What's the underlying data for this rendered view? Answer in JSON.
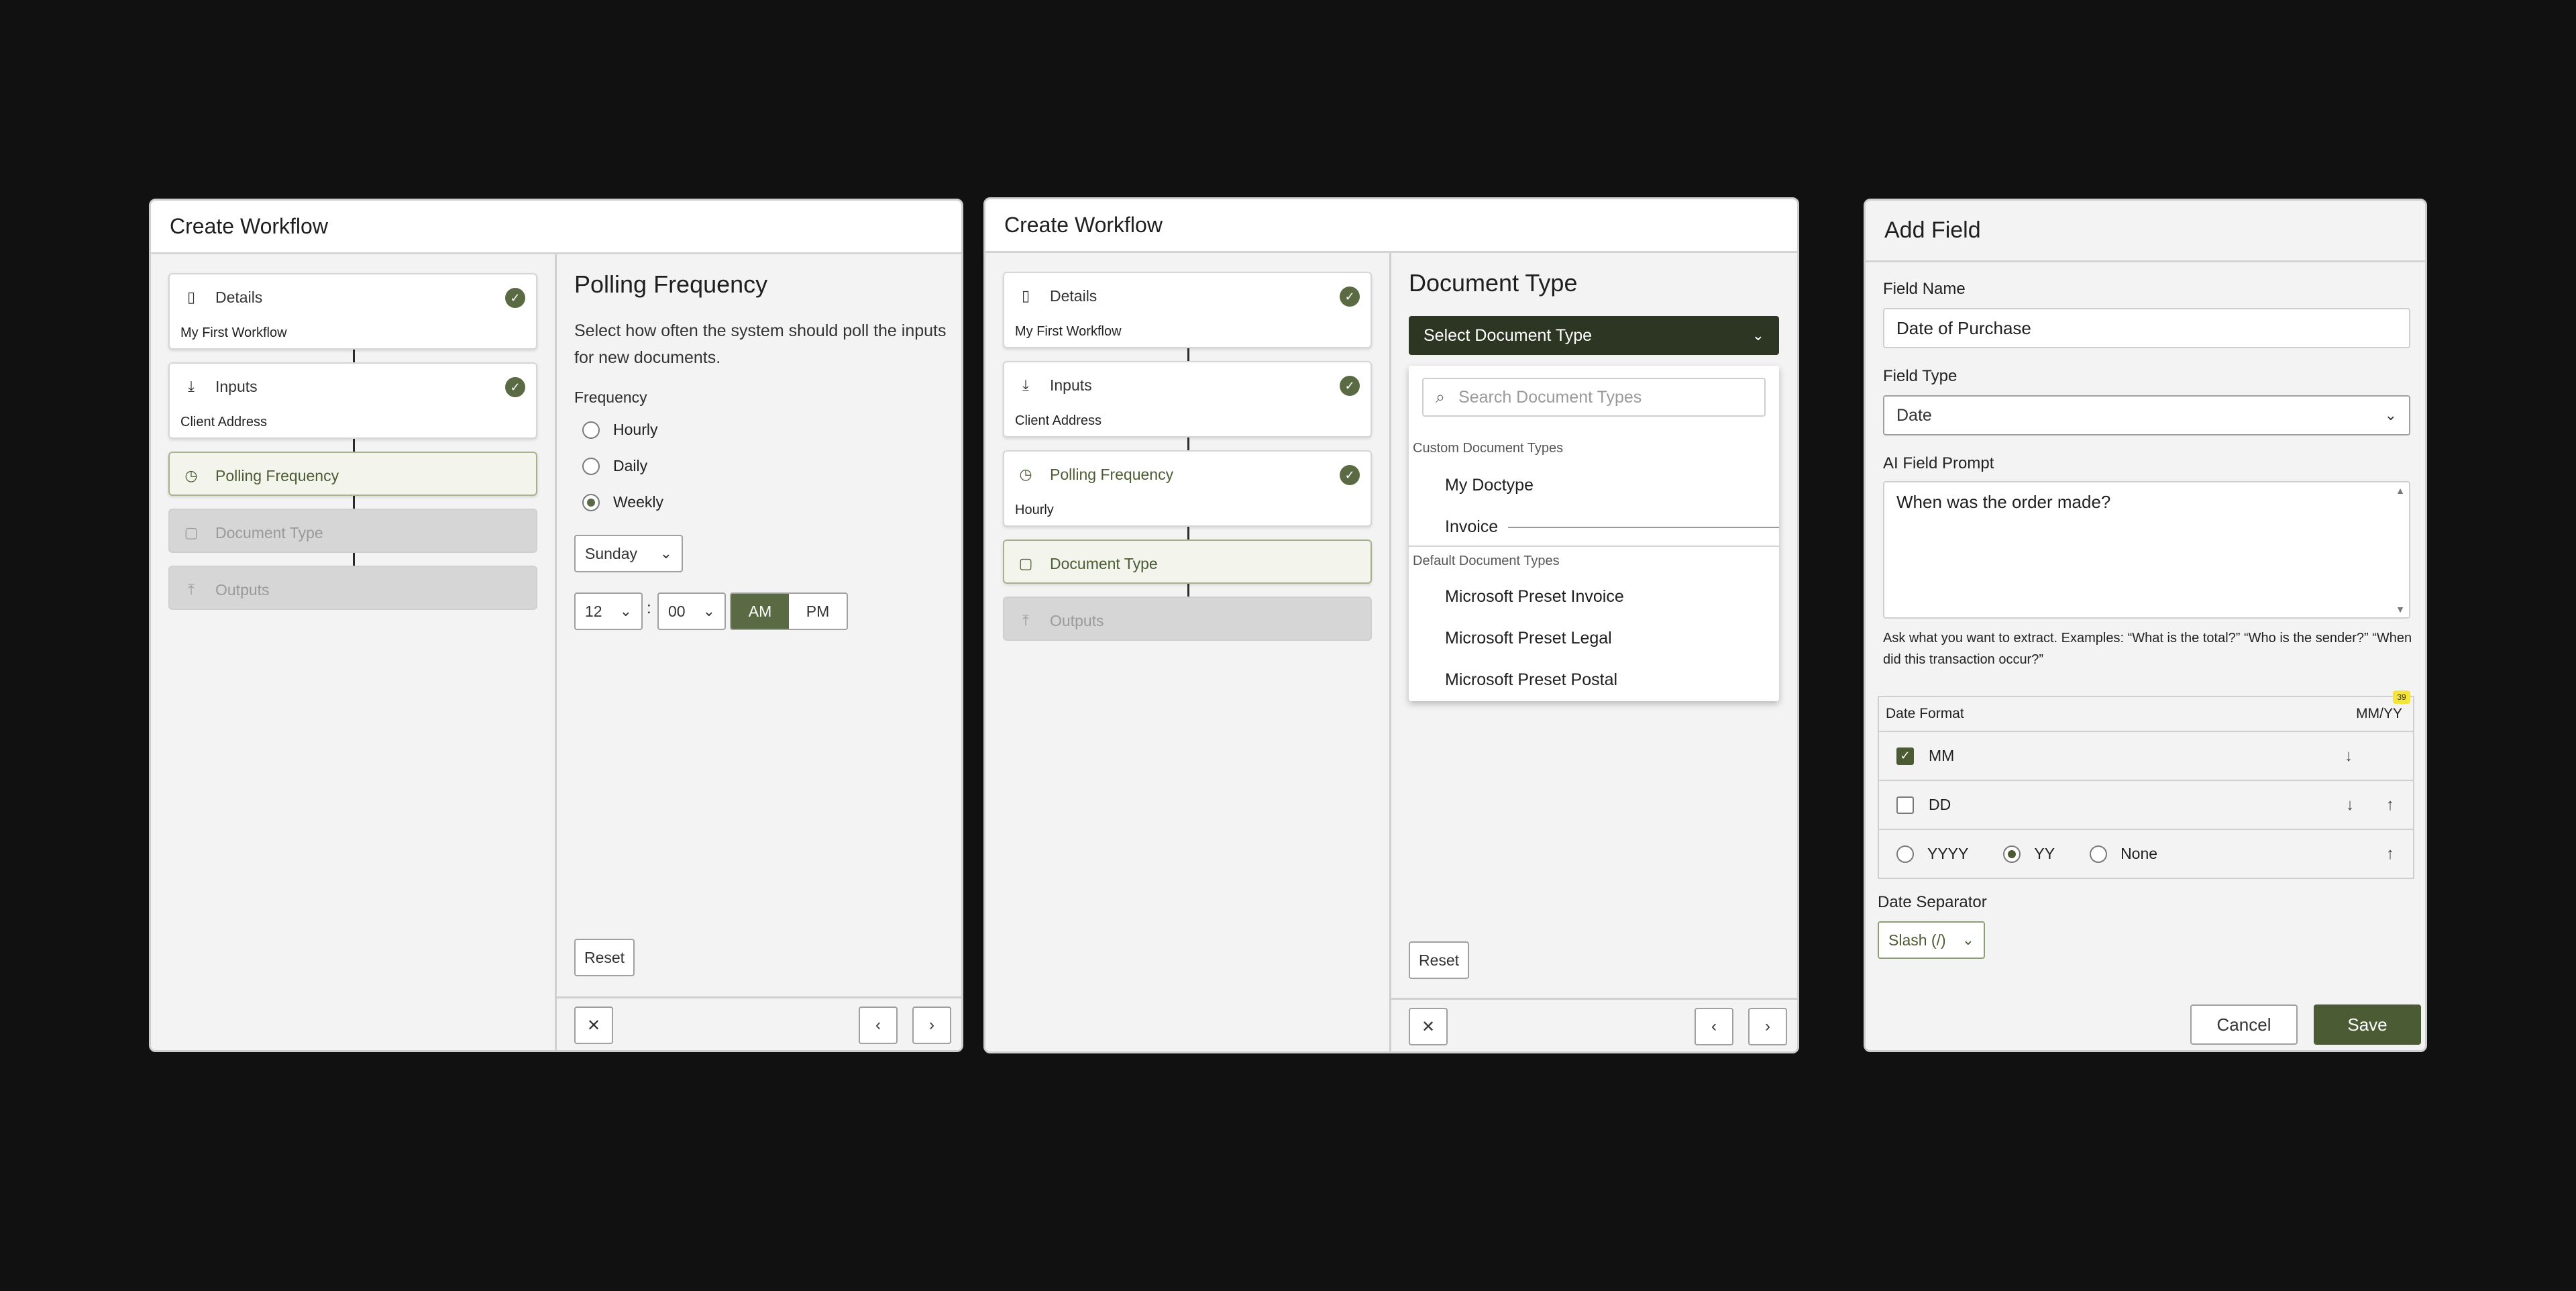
{
  "panel1": {
    "title": "Create Workflow",
    "steps": [
      {
        "label": "Details",
        "sub": "My First Workflow"
      },
      {
        "label": "Inputs",
        "sub": "Client Address"
      },
      {
        "label": "Polling Frequency"
      },
      {
        "label": "Document Type"
      },
      {
        "label": "Outputs"
      }
    ],
    "heading": "Polling Frequency",
    "description": "Select how often the system should poll the inputs for new documents.",
    "frequency_label": "Frequency",
    "options": [
      "Hourly",
      "Daily",
      "Weekly"
    ],
    "selected_option": "Weekly",
    "day": "Sunday",
    "hour": "12",
    "minute": "00",
    "time_sep": ":",
    "am": "AM",
    "pm": "PM",
    "reset": "Reset"
  },
  "panel2": {
    "title": "Create Workflow",
    "steps": [
      {
        "label": "Details",
        "sub": "My First Workflow"
      },
      {
        "label": "Inputs",
        "sub": "Client Address"
      },
      {
        "label": "Polling Frequency",
        "sub": "Hourly"
      },
      {
        "label": "Document Type"
      },
      {
        "label": "Outputs"
      }
    ],
    "heading": "Document Type",
    "dropdown_label": "Select Document Type",
    "search_placeholder": "Search Document Types",
    "custom_group": "Custom Document Types",
    "custom_items": [
      "My Doctype",
      "Invoice"
    ],
    "default_group": "Default Document Types",
    "default_items": [
      "Microsoft Preset Invoice",
      "Microsoft Preset Legal",
      "Microsoft Preset Postal"
    ],
    "reset": "Reset"
  },
  "panel3": {
    "title": "Add Field",
    "field_name_label": "Field Name",
    "field_name_value": "Date of Purchase",
    "field_type_label": "Field Type",
    "field_type_value": "Date",
    "prompt_label": "AI Field Prompt",
    "prompt_value": "When was the order made?",
    "help_text": "Ask what you want to extract. Examples: “What is the total?” “Who is the sender?” “When did this transaction occur?”",
    "date_format_label": "Date Format",
    "date_format_value": "MM/YY",
    "badge": "39",
    "mm": "MM",
    "dd": "DD",
    "yyyy": "YYYY",
    "yy": "YY",
    "none": "None",
    "separator_label": "Date Separator",
    "separator_value": "Slash (/)",
    "cancel": "Cancel",
    "save": "Save"
  }
}
